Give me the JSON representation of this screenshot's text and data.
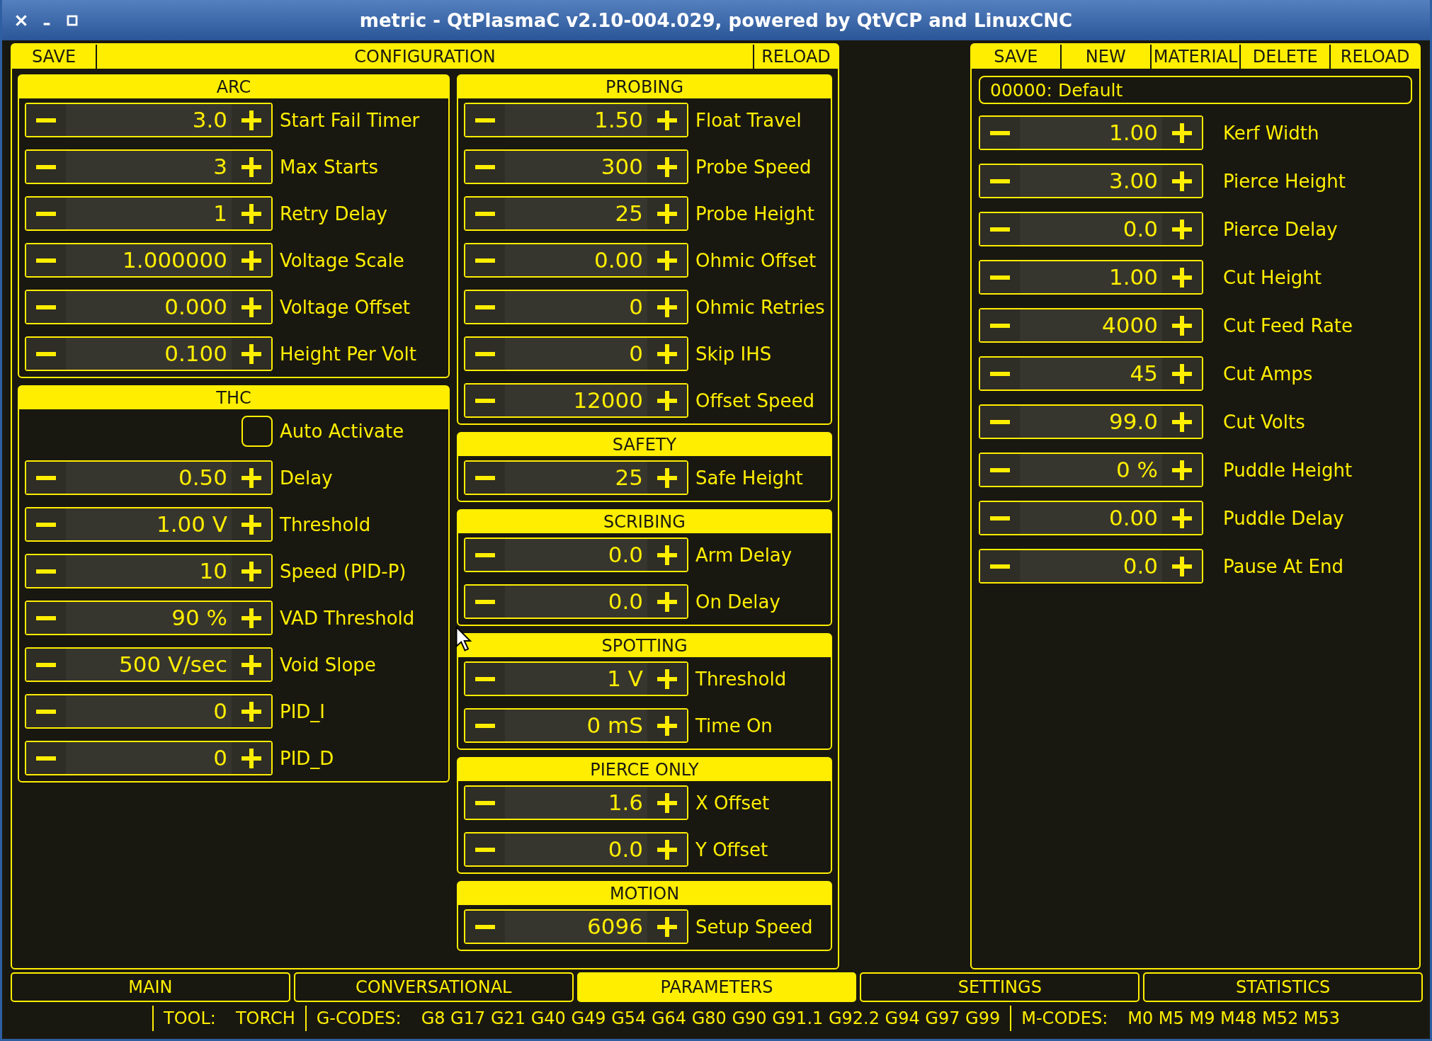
{
  "window": {
    "title": "metric - QtPlasmaC v2.10-004.029, powered by QtVCP and LinuxCNC"
  },
  "configuration": {
    "save_button": "SAVE",
    "title": "CONFIGURATION",
    "reload_button": "RELOAD",
    "columns": [
      [
        {
          "title": "ARC",
          "rows": [
            {
              "kind": "spinbox",
              "value": "3.0",
              "label": "Start Fail Timer"
            },
            {
              "kind": "spinbox",
              "value": "3",
              "label": "Max Starts"
            },
            {
              "kind": "spinbox",
              "value": "1",
              "label": "Retry Delay"
            },
            {
              "kind": "spinbox",
              "value": "1.000000",
              "label": "Voltage Scale"
            },
            {
              "kind": "spinbox",
              "value": "0.000",
              "label": "Voltage Offset"
            },
            {
              "kind": "spinbox",
              "value": "0.100",
              "label": "Height Per Volt"
            }
          ]
        },
        {
          "title": "THC",
          "rows": [
            {
              "kind": "checkbox",
              "checked": false,
              "label": "Auto Activate"
            },
            {
              "kind": "spinbox",
              "value": "0.50",
              "label": "Delay"
            },
            {
              "kind": "spinbox",
              "value": "1.00 V",
              "label": "Threshold"
            },
            {
              "kind": "spinbox",
              "value": "10",
              "label": "Speed (PID-P)"
            },
            {
              "kind": "spinbox",
              "value": "90 %",
              "label": "VAD Threshold"
            },
            {
              "kind": "spinbox",
              "value": "500 V/sec",
              "label": "Void Slope"
            },
            {
              "kind": "spinbox",
              "value": "0",
              "label": "PID_I"
            },
            {
              "kind": "spinbox",
              "value": "0",
              "label": "PID_D"
            }
          ]
        }
      ],
      [
        {
          "title": "PROBING",
          "rows": [
            {
              "kind": "spinbox",
              "value": "1.50",
              "label": "Float Travel"
            },
            {
              "kind": "spinbox",
              "value": "300",
              "label": "Probe Speed"
            },
            {
              "kind": "spinbox",
              "value": "25",
              "label": "Probe Height"
            },
            {
              "kind": "spinbox",
              "value": "0.00",
              "label": "Ohmic Offset"
            },
            {
              "kind": "spinbox",
              "value": "0",
              "label": "Ohmic Retries"
            },
            {
              "kind": "spinbox",
              "value": "0",
              "label": "Skip IHS"
            },
            {
              "kind": "spinbox",
              "value": "12000",
              "label": "Offset Speed"
            }
          ]
        },
        {
          "title": "SAFETY",
          "rows": [
            {
              "kind": "spinbox",
              "value": "25",
              "label": "Safe Height"
            }
          ]
        },
        {
          "title": "SCRIBING",
          "rows": [
            {
              "kind": "spinbox",
              "value": "0.0",
              "label": "Arm Delay"
            },
            {
              "kind": "spinbox",
              "value": "0.0",
              "label": "On Delay"
            }
          ]
        },
        {
          "title": "SPOTTING",
          "rows": [
            {
              "kind": "spinbox",
              "value": "1 V",
              "label": "Threshold"
            },
            {
              "kind": "spinbox",
              "value": "0 mS",
              "label": "Time On"
            }
          ]
        },
        {
          "title": "PIERCE ONLY",
          "rows": [
            {
              "kind": "spinbox",
              "value": "1.6",
              "label": "X Offset"
            },
            {
              "kind": "spinbox",
              "value": "0.0",
              "label": "Y Offset"
            }
          ]
        },
        {
          "title": "MOTION",
          "rows": [
            {
              "kind": "spinbox",
              "value": "6096",
              "label": "Setup Speed"
            }
          ]
        }
      ]
    ]
  },
  "material": {
    "buttons": [
      "SAVE",
      "NEW",
      "MATERIAL",
      "DELETE",
      "RELOAD"
    ],
    "selector": "00000: Default",
    "rows": [
      {
        "value": "1.00",
        "label": "Kerf Width"
      },
      {
        "value": "3.00",
        "label": "Pierce Height"
      },
      {
        "value": "0.0",
        "label": "Pierce Delay"
      },
      {
        "value": "1.00",
        "label": "Cut Height"
      },
      {
        "value": "4000",
        "label": "Cut Feed Rate"
      },
      {
        "value": "45",
        "label": "Cut Amps"
      },
      {
        "value": "99.0",
        "label": "Cut Volts"
      },
      {
        "value": "0 %",
        "label": "Puddle Height"
      },
      {
        "value": "0.00",
        "label": "Puddle Delay"
      },
      {
        "value": "0.0",
        "label": "Pause At End"
      }
    ]
  },
  "tabs": [
    {
      "label": "MAIN",
      "selected": false
    },
    {
      "label": "CONVERSATIONAL",
      "selected": false
    },
    {
      "label": "PARAMETERS",
      "selected": true
    },
    {
      "label": "SETTINGS",
      "selected": false
    },
    {
      "label": "STATISTICS",
      "selected": false
    }
  ],
  "status_bar": {
    "tool_label": "TOOL:",
    "tool": "TORCH",
    "gcodes_label": "G-CODES:",
    "gcodes": "G8 G17 G21 G40 G49 G54 G64 G80 G90 G91.1 G92.2 G94 G97 G99",
    "mcodes_label": "M-CODES:",
    "mcodes": "M0 M5 M9 M48 M52 M53"
  }
}
